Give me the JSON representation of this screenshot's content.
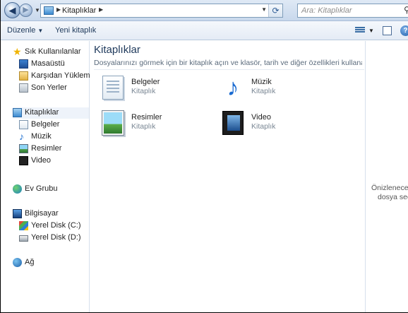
{
  "address": {
    "crumb": "Kitaplıklar",
    "search_placeholder": "Ara: Kitaplıklar"
  },
  "toolbar": {
    "organize_label": "Düzenle",
    "new_library_label": "Yeni kitaplık"
  },
  "nav": {
    "favorites": "Sık Kullanılanlar",
    "desktop": "Masaüstü",
    "downloads": "Karşıdan Yüklemeler",
    "recent": "Son Yerler",
    "libraries": "Kitaplıklar",
    "documents": "Belgeler",
    "music": "Müzik",
    "pictures": "Resimler",
    "video": "Video",
    "homegroup": "Ev Grubu",
    "computer": "Bilgisayar",
    "disk_c": "Yerel Disk (C:)",
    "disk_d": "Yerel Disk (D:)",
    "network": "Ağ"
  },
  "main": {
    "title": "Kitaplıklar",
    "description": "Dosyalarınızı görmek için bir kitaplık açın ve klasör, tarih ve diğer özellikleri kullanarak dosyalarınızı ...",
    "libraries": [
      {
        "name": "Belgeler",
        "type": "Kitaplık"
      },
      {
        "name": "Müzik",
        "type": "Kitaplık"
      },
      {
        "name": "Resimler",
        "type": "Kitaplık"
      },
      {
        "name": "Video",
        "type": "Kitaplık"
      }
    ]
  },
  "preview": {
    "line1": "Önizlenecek bir",
    "line2": "dosya seçin."
  }
}
